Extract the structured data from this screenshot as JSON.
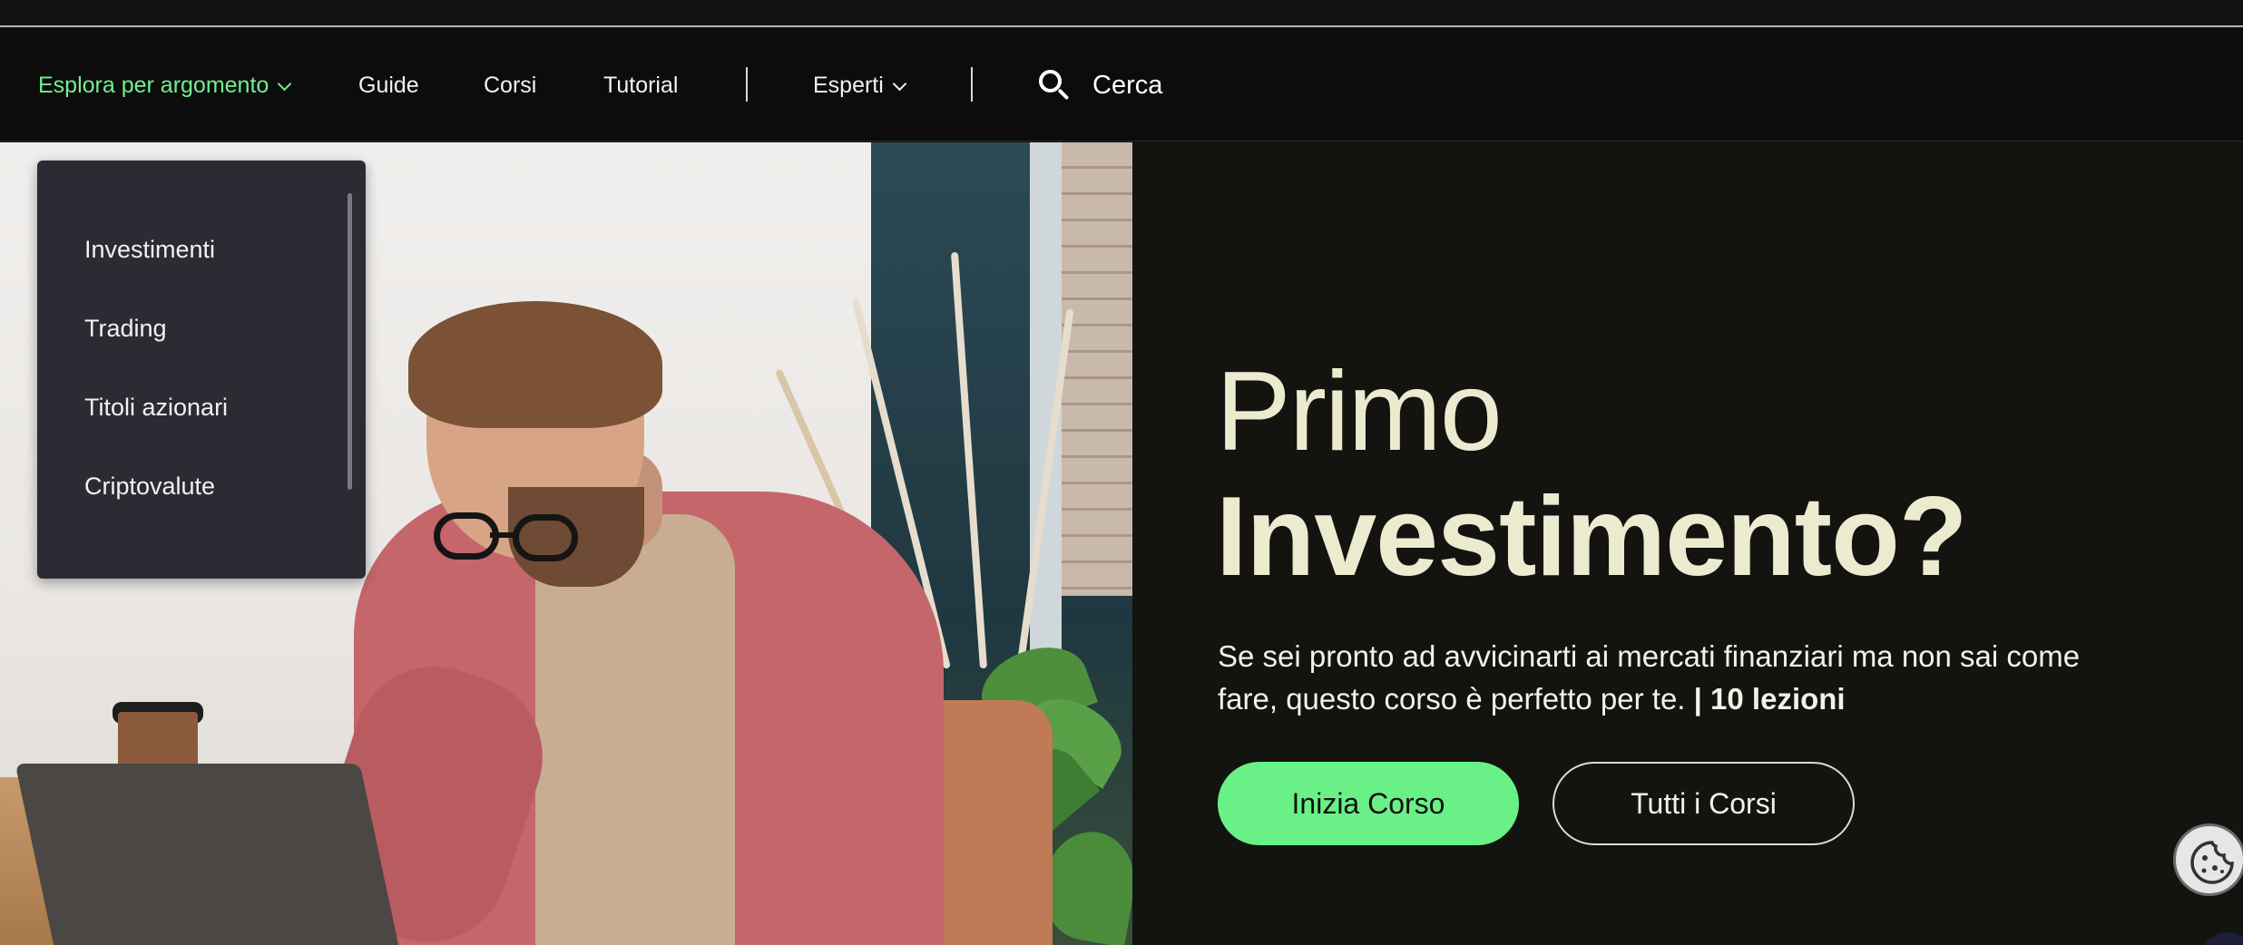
{
  "nav": {
    "explore_label": "Esplora per argomento",
    "guide_label": "Guide",
    "courses_label": "Corsi",
    "tutorial_label": "Tutorial",
    "experts_label": "Esperti",
    "search_label": "Cerca"
  },
  "dropdown": {
    "items": [
      {
        "label": "Investimenti"
      },
      {
        "label": "Trading"
      },
      {
        "label": "Titoli azionari"
      },
      {
        "label": "Criptovalute"
      }
    ]
  },
  "hero": {
    "title_line1": "Primo",
    "title_line2": "Investimento?",
    "description": "Se sei pronto ad avvicinarti ai mercati finanziari ma non sai come fare, questo corso è perfetto per te.",
    "lessons": "| 10 lezioni",
    "primary_button": "Inizia Corso",
    "secondary_button": "Tutti i Corsi"
  },
  "icons": {
    "search": "search-icon",
    "chevron": "chevron-down-icon",
    "cookie": "cookie-icon"
  },
  "colors": {
    "accent": "#69f187",
    "nav_active": "#72ef8e",
    "heading": "#eceacf",
    "panel_bg": "#131310",
    "menu_bg": "#2b2c33"
  }
}
